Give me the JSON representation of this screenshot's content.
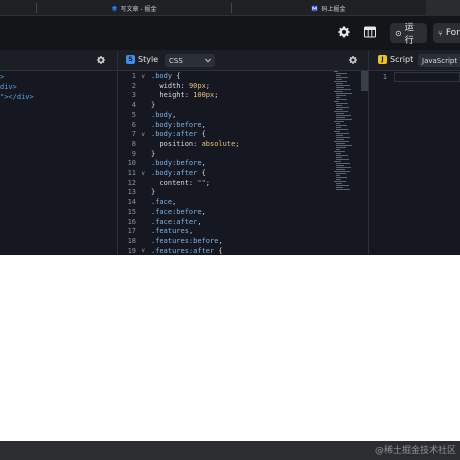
{
  "browser_tabs": [
    {
      "label": "写文章 - 掘金"
    },
    {
      "label": "码上掘金"
    }
  ],
  "toolbar": {
    "run_label": "运行",
    "run_glyph": "⊙",
    "fork_label": "For",
    "fork_glyph": "⑂",
    "settings_icon": "gear-icon",
    "layout_icon": "grid-layout-icon"
  },
  "html_panel": {
    "lines": [
      ">",
      "div>",
      "\"></div>"
    ]
  },
  "style_panel": {
    "title": "Style",
    "badge": "S",
    "language": "CSS",
    "code": [
      {
        "n": "1",
        "fold": "∨",
        "parts": [
          [
            "sel",
            ".body"
          ],
          [
            "punc",
            " {"
          ]
        ]
      },
      {
        "n": "2",
        "fold": "",
        "parts": [
          [
            "prop",
            "  width: "
          ],
          [
            "num",
            "90px"
          ],
          [
            "punc",
            ";"
          ]
        ]
      },
      {
        "n": "3",
        "fold": "",
        "parts": [
          [
            "prop",
            "  height: "
          ],
          [
            "num",
            "100px"
          ],
          [
            "punc",
            ";"
          ]
        ]
      },
      {
        "n": "4",
        "fold": "",
        "parts": [
          [
            "punc",
            "}"
          ]
        ]
      },
      {
        "n": "5",
        "fold": "",
        "parts": [
          [
            "sel",
            ".body"
          ],
          [
            "punc",
            ","
          ]
        ]
      },
      {
        "n": "6",
        "fold": "",
        "parts": [
          [
            "sel",
            ".body:before"
          ],
          [
            "punc",
            ","
          ]
        ]
      },
      {
        "n": "7",
        "fold": "∨",
        "parts": [
          [
            "sel",
            ".body:after"
          ],
          [
            "punc",
            " {"
          ]
        ]
      },
      {
        "n": "8",
        "fold": "",
        "parts": [
          [
            "prop",
            "  position: "
          ],
          [
            "kw",
            "absolute"
          ],
          [
            "punc",
            ";"
          ]
        ]
      },
      {
        "n": "9",
        "fold": "",
        "parts": [
          [
            "punc",
            "}"
          ]
        ]
      },
      {
        "n": "10",
        "fold": "",
        "parts": [
          [
            "sel",
            ".body:before"
          ],
          [
            "punc",
            ","
          ]
        ]
      },
      {
        "n": "11",
        "fold": "∨",
        "parts": [
          [
            "sel",
            ".body:after"
          ],
          [
            "punc",
            " {"
          ]
        ]
      },
      {
        "n": "12",
        "fold": "",
        "parts": [
          [
            "prop",
            "  content: "
          ],
          [
            "str",
            "\"\""
          ],
          [
            "punc",
            ";"
          ]
        ]
      },
      {
        "n": "13",
        "fold": "",
        "parts": [
          [
            "punc",
            "}"
          ]
        ]
      },
      {
        "n": "14",
        "fold": "",
        "parts": [
          [
            "sel",
            ".face"
          ],
          [
            "punc",
            ","
          ]
        ]
      },
      {
        "n": "15",
        "fold": "",
        "parts": [
          [
            "sel",
            ".face:before"
          ],
          [
            "punc",
            ","
          ]
        ]
      },
      {
        "n": "16",
        "fold": "",
        "parts": [
          [
            "sel",
            ".face:after"
          ],
          [
            "punc",
            ","
          ]
        ]
      },
      {
        "n": "17",
        "fold": "",
        "parts": [
          [
            "sel",
            ".features"
          ],
          [
            "punc",
            ","
          ]
        ]
      },
      {
        "n": "18",
        "fold": "",
        "parts": [
          [
            "sel",
            ".features:before"
          ],
          [
            "punc",
            ","
          ]
        ]
      },
      {
        "n": "19",
        "fold": "∨",
        "parts": [
          [
            "sel",
            ".features:after"
          ],
          [
            "punc",
            " {"
          ]
        ]
      }
    ]
  },
  "script_panel": {
    "title": "Script",
    "badge": "J",
    "language": "JavaScript",
    "line_numbers": [
      "1"
    ]
  },
  "watermark": "@稀土掘金技术社区",
  "colors": {
    "style_badge": "#3b8eea",
    "script_badge": "#f0c419"
  }
}
